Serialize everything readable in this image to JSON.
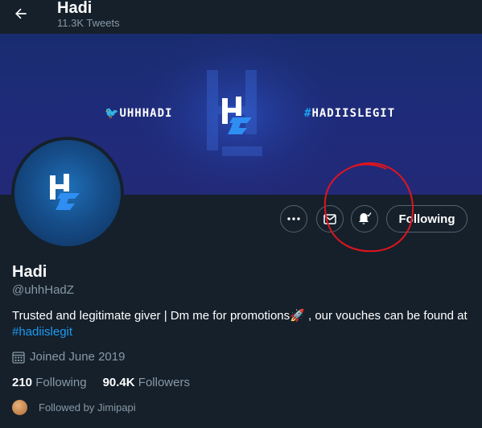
{
  "header": {
    "title": "Hadi",
    "tweet_count": "11.3K Tweets"
  },
  "banner": {
    "left_tag": "UHHHADI",
    "right_tag": "HADIISLEGIT",
    "hash": "#"
  },
  "actions": {
    "following_label": "Following"
  },
  "profile": {
    "name": "Hadi",
    "handle": "@uhhHadZ",
    "bio_text": "Trusted and legitimate giver | Dm me for promotions🚀 , our vouches can be found at",
    "bio_hashtag": "#hadiislegit",
    "joined": "Joined June 2019",
    "following_count": "210",
    "following_label": "Following",
    "followers_count": "90.4K",
    "followers_label": "Followers",
    "followed_by": "Followed by Jimipapi"
  },
  "colors": {
    "background": "#15202b",
    "accent": "#1d9bf0",
    "muted": "#8899a6",
    "annotation": "#e0141e"
  }
}
